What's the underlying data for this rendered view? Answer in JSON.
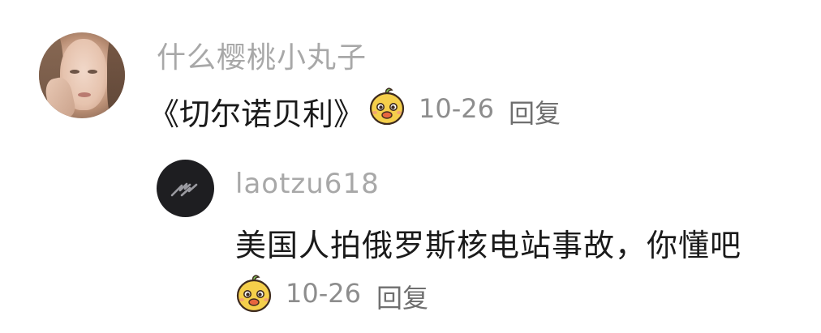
{
  "comment": {
    "username": "什么樱桃小丸子",
    "text": "《切尔诺贝利》",
    "emoji": "smiling-bean-emoji",
    "time": "10-26",
    "reply_label": "回复"
  },
  "reply": {
    "username": "laotzu618",
    "avatar_icon": "lightning-bolt-icon",
    "text": "美国人拍俄罗斯核电站事故，你懂吧",
    "emoji": "smiling-bean-emoji",
    "time": "10-26",
    "reply_label": "回复"
  },
  "colors": {
    "username": "#a8a8a8",
    "text": "#1a1a1a",
    "meta": "#8d8d8d",
    "emoji_face": "#f5cf4b",
    "emoji_leaf": "#7fc25a"
  }
}
